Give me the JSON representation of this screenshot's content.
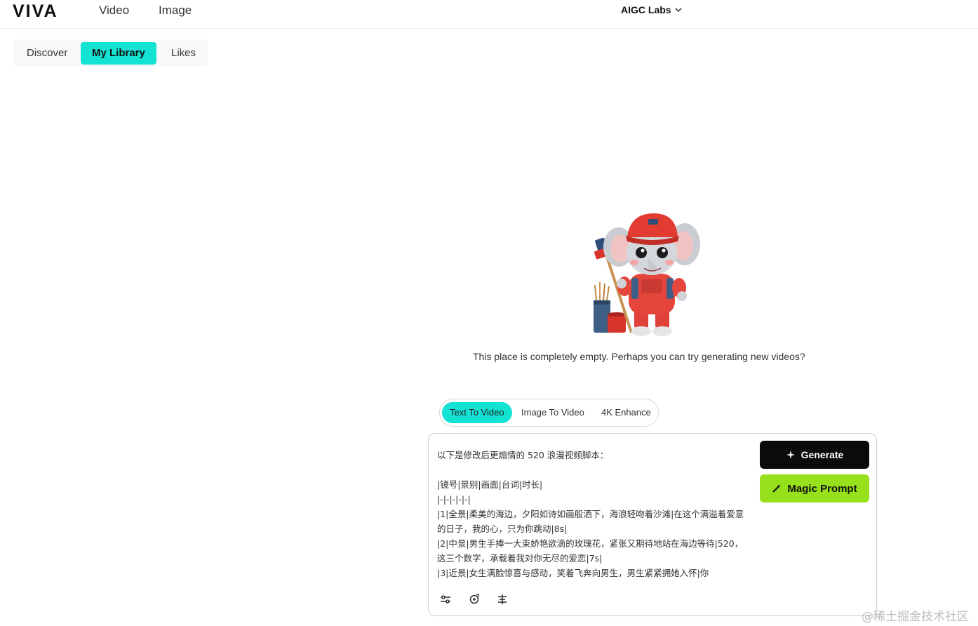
{
  "header": {
    "logo_text": "VIVA",
    "nav_video": "Video",
    "nav_image": "Image",
    "org_label": "AIGC Labs",
    "accent_gradient": [
      "#1677ff",
      "#14d9d0"
    ]
  },
  "library_tabs": {
    "discover": "Discover",
    "my_library": "My Library",
    "likes": "Likes",
    "active_color": "#14e3d4"
  },
  "empty_state": {
    "message": "This place is completely empty. Perhaps you can try generating new videos?",
    "illustration": "elephant-painter-mascot"
  },
  "mode_tabs": {
    "text_to_video": "Text To Video",
    "image_to_video": "Image To Video",
    "enhance": "4K Enhance",
    "active": "Text To Video"
  },
  "prompt": {
    "value": "以下是修改后更煽情的 520 浪漫视频脚本：\n\n|镜号|景别|画面|台词|时长|\n|-|-|-|-|-|\n|1|全景|柔美的海边，夕阳如诗如画般洒下，海浪轻吻着沙滩|在这个满溢着爱意的日子，我的心，只为你跳动|8s|\n|2|中景|男生手捧一大束娇艳欲滴的玫瑰花，紧张又期待地站在海边等待|520，这三个数字，承载着我对你无尽的爱恋|7s|\n|3|近景|女生满脸惊喜与感动，笑着飞奔向男生，男生紧紧拥她入怀|你",
    "generate_label": "Generate",
    "magic_label": "Magic Prompt",
    "generate_color": "#0b0b0b",
    "magic_color": "#96e01c"
  },
  "watermark": "@稀土掘金技术社区"
}
